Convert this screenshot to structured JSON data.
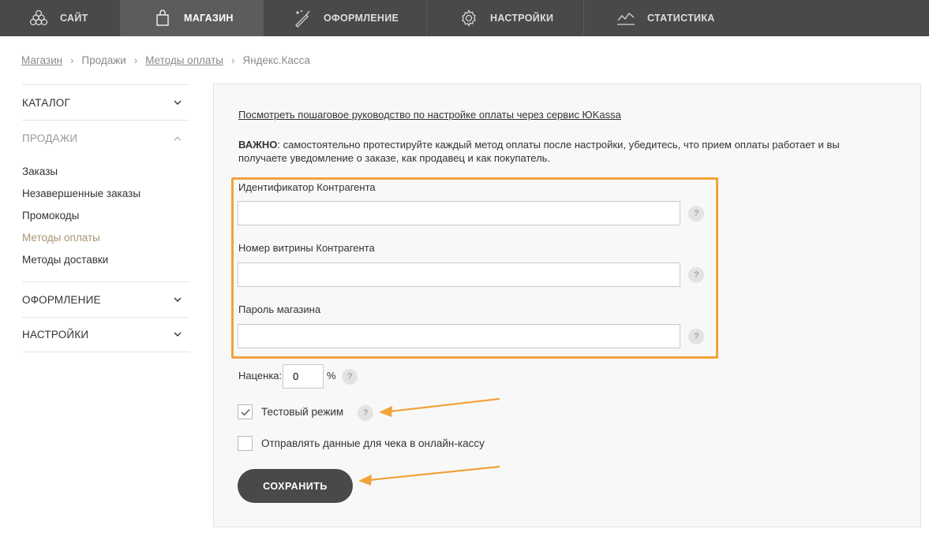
{
  "nav": {
    "tabs": [
      {
        "label": "САЙТ",
        "icon": "molecule-icon"
      },
      {
        "label": "МАГАЗИН",
        "icon": "shopping-bag-icon",
        "active": true
      },
      {
        "label": "ОФОРМЛЕНИЕ",
        "icon": "magic-brush-icon"
      },
      {
        "label": "НАСТРОЙКИ",
        "icon": "gear-icon"
      },
      {
        "label": "СТАТИСТИКА",
        "icon": "line-chart-icon"
      }
    ]
  },
  "breadcrumb": {
    "items": [
      "Магазин",
      "Продажи",
      "Методы оплаты"
    ],
    "current": "Яндекс.Касса"
  },
  "sidebar": {
    "groups": [
      {
        "title": "КАТАЛОГ",
        "open": false
      },
      {
        "title": "ПРОДАЖИ",
        "open": true,
        "items": [
          "Заказы",
          "Незавершенные заказы",
          "Промокоды",
          "Методы оплаты",
          "Методы доставки"
        ],
        "active_item": "Методы оплаты"
      },
      {
        "title": "ОФОРМЛЕНИЕ",
        "open": false
      },
      {
        "title": "НАСТРОЙКИ",
        "open": false
      }
    ]
  },
  "main": {
    "guide_link": "Посмотреть пошаговое руководство по настройке оплаты через сервис ЮKassa",
    "important_bold": "ВАЖНО",
    "important_text": ": самостоятельно протестируйте каждый метод оплаты после настройки, убедитесь, что прием оплаты работает и вы получаете уведомление о заказе, как продавец и как покупатель.",
    "fields": [
      {
        "label": "Идентификатор Контрагента",
        "value": ""
      },
      {
        "label": "Номер витрины Контрагента",
        "value": ""
      },
      {
        "label": "Пароль магазина",
        "value": ""
      }
    ],
    "help_symbol": "?",
    "markup_label": "Наценка:",
    "markup_value": "0",
    "markup_unit": "%",
    "test_mode": {
      "label": "Тестовый режим",
      "checked": true
    },
    "send_receipt": {
      "label": "Отправлять данные для чека в онлайн-кассу",
      "checked": false
    },
    "save_label": "СОХРАНИТЬ"
  },
  "colors": {
    "nav_bg": "#4a4948",
    "highlight": "#f2a23b",
    "active_link": "#a89373",
    "button_bg": "#4a4948"
  }
}
